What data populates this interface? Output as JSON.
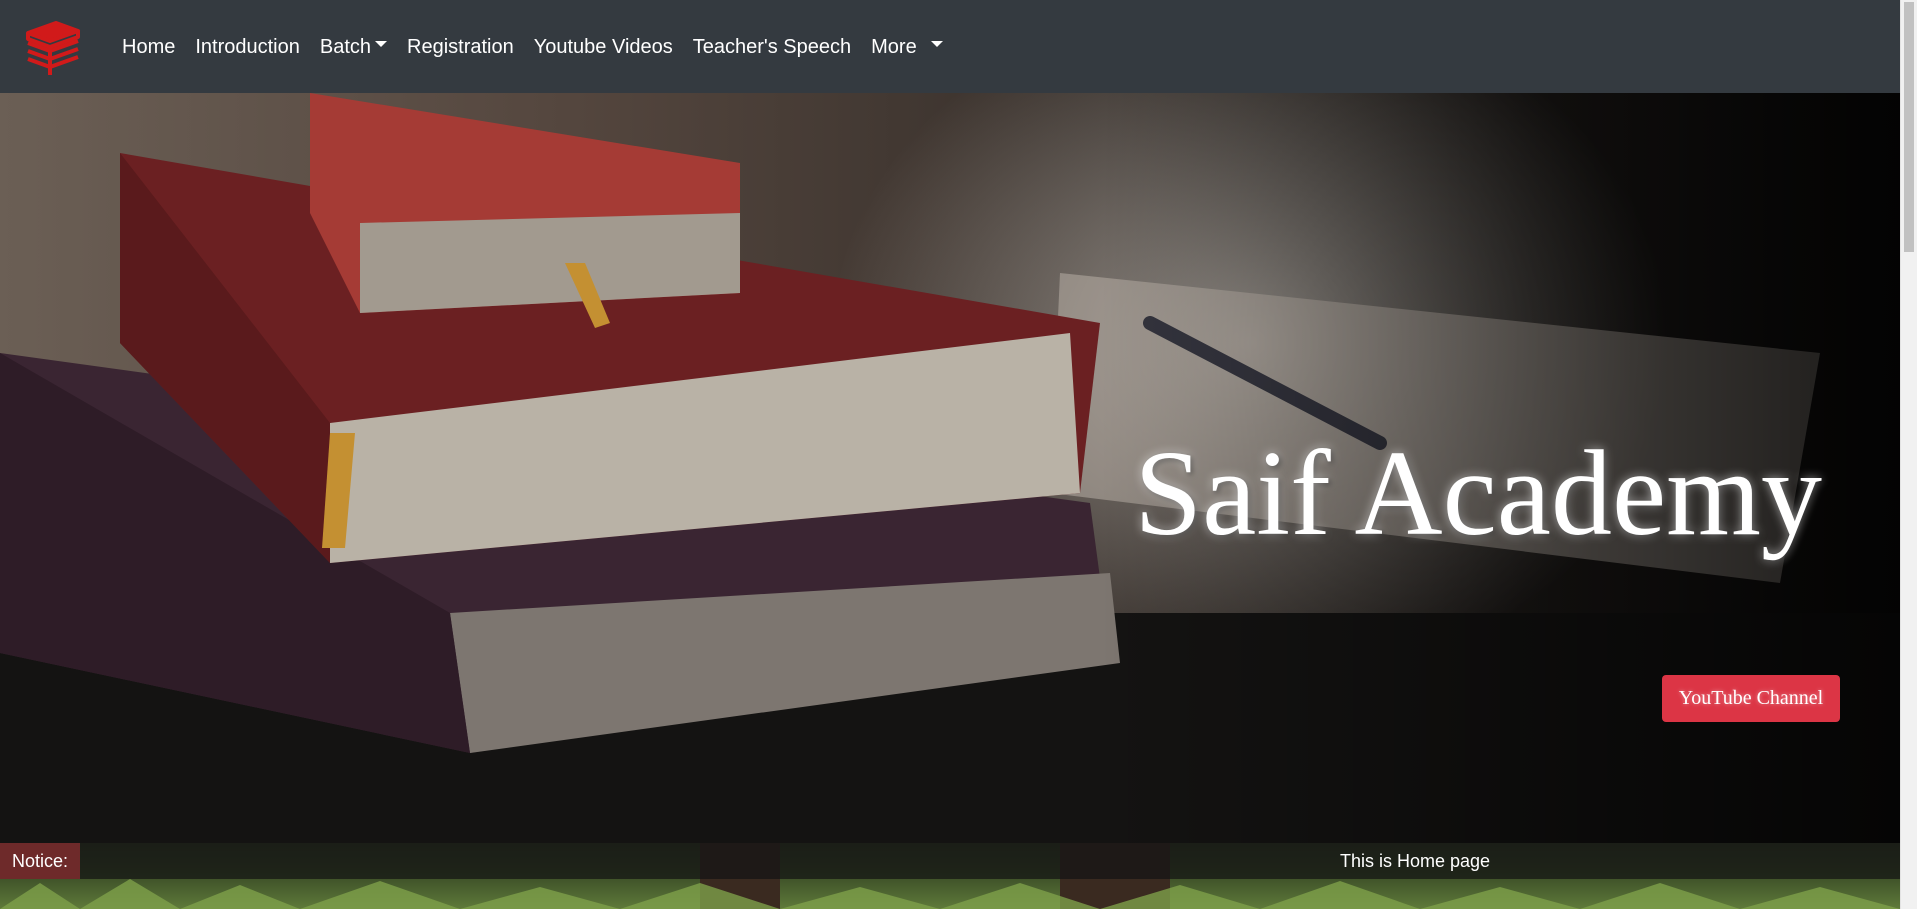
{
  "navbar": {
    "logo_icon": "book-stack-icon",
    "links": [
      {
        "label": "Home",
        "dropdown": false
      },
      {
        "label": "Introduction",
        "dropdown": false
      },
      {
        "label": "Batch",
        "dropdown": true
      },
      {
        "label": "Registration",
        "dropdown": false
      },
      {
        "label": "Youtube Videos",
        "dropdown": false
      },
      {
        "label": "Teacher's Speech",
        "dropdown": false
      },
      {
        "label": "More",
        "dropdown": true
      }
    ]
  },
  "hero": {
    "title": "Saif Academy",
    "button_label": "YouTube Channel",
    "background_icon": "books-photo"
  },
  "notice": {
    "label": "Notice:",
    "text": "This is Home page"
  },
  "colors": {
    "navbar_bg": "#343a40",
    "button_bg": "#dc3545",
    "logo": "#d11a1a",
    "notice_label_bg": "#6e2a2a"
  }
}
